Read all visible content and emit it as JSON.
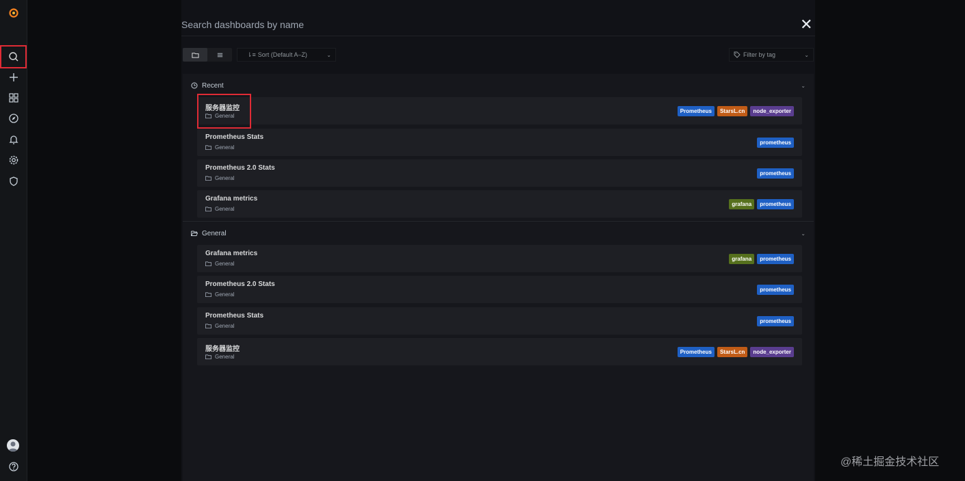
{
  "sidebar": {
    "logo": "grafana-logo",
    "items": [
      {
        "icon": "search-icon"
      },
      {
        "icon": "plus-icon"
      },
      {
        "icon": "dashboards-icon"
      },
      {
        "icon": "compass-icon"
      },
      {
        "icon": "bell-icon"
      },
      {
        "icon": "gear-icon"
      },
      {
        "icon": "shield-icon"
      }
    ],
    "bottom": [
      {
        "icon": "avatar"
      },
      {
        "icon": "help-icon"
      }
    ]
  },
  "search": {
    "placeholder": "Search dashboards by name",
    "value": ""
  },
  "toolbar": {
    "sort_label": "Sort (Default A–Z)",
    "tag_filter_placeholder": "Filter by tag"
  },
  "sections": {
    "recent": {
      "title": "Recent",
      "items": [
        {
          "title": "服务器监控",
          "folder": "General",
          "tags": [
            "Prometheus",
            "StarsL.cn",
            "node_exporter"
          ]
        },
        {
          "title": "Prometheus Stats",
          "folder": "General",
          "tags": [
            "prometheus"
          ]
        },
        {
          "title": "Prometheus 2.0 Stats",
          "folder": "General",
          "tags": [
            "prometheus"
          ]
        },
        {
          "title": "Grafana metrics",
          "folder": "General",
          "tags": [
            "grafana",
            "prometheus"
          ]
        }
      ]
    },
    "general": {
      "title": "General",
      "items": [
        {
          "title": "Grafana metrics",
          "folder": "General",
          "tags": [
            "grafana",
            "prometheus"
          ]
        },
        {
          "title": "Prometheus 2.0 Stats",
          "folder": "General",
          "tags": [
            "prometheus"
          ]
        },
        {
          "title": "Prometheus Stats",
          "folder": "General",
          "tags": [
            "prometheus"
          ]
        },
        {
          "title": "服务器监控",
          "folder": "General",
          "tags": [
            "Prometheus",
            "StarsL.cn",
            "node_exporter"
          ]
        }
      ]
    }
  },
  "tag_colors": {
    "Prometheus": "#1f60c4",
    "prometheus": "#1f60c4",
    "StarsL.cn": "#c15c17",
    "node_exporter": "#5a3d8f",
    "grafana": "#56701d"
  },
  "watermark": "@稀土掘金技术社区"
}
